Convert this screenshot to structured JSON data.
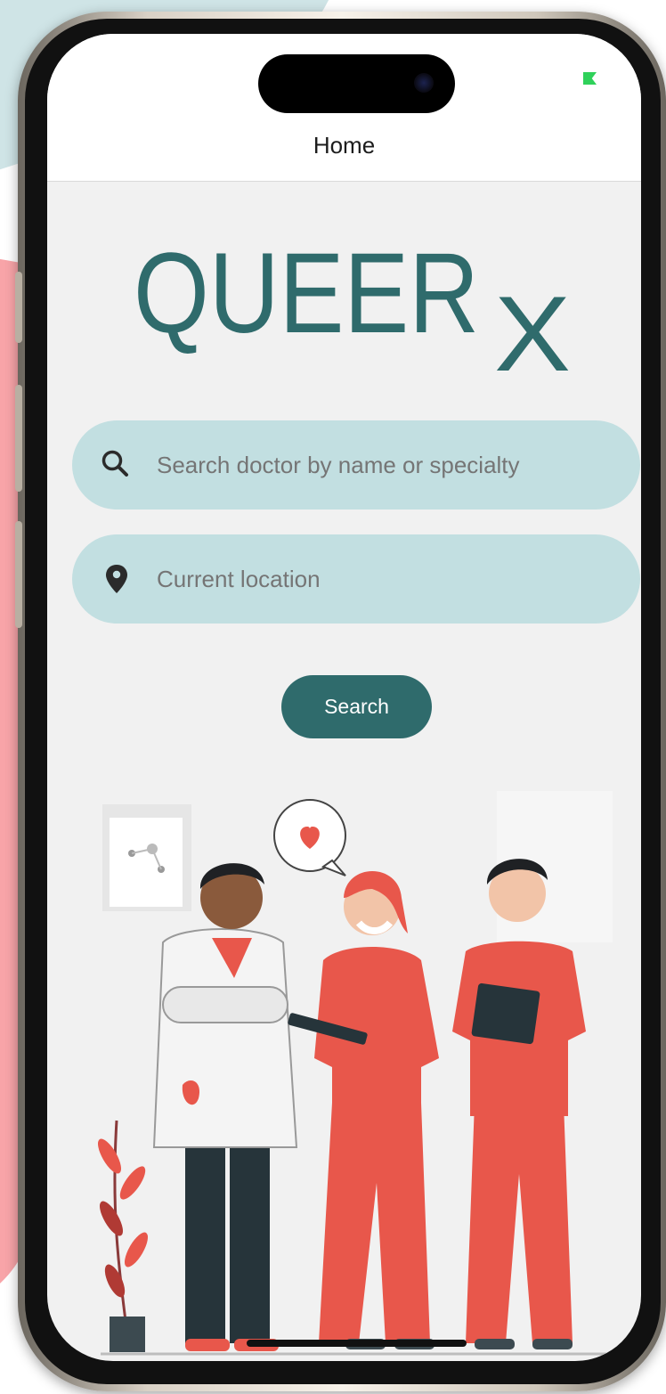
{
  "nav": {
    "title": "Home"
  },
  "logo": {
    "main": "QUEER",
    "suffix": "X"
  },
  "search": {
    "placeholder": "Search doctor by name or specialty",
    "icon": "search-icon"
  },
  "location": {
    "placeholder": "Current location",
    "icon": "location-pin-icon"
  },
  "search_button": {
    "label": "Search"
  },
  "colors": {
    "brand": "#2f6b6c",
    "field_bg": "#c2dfe1",
    "accent": "#e8574b",
    "background": "#f1f1f1"
  }
}
